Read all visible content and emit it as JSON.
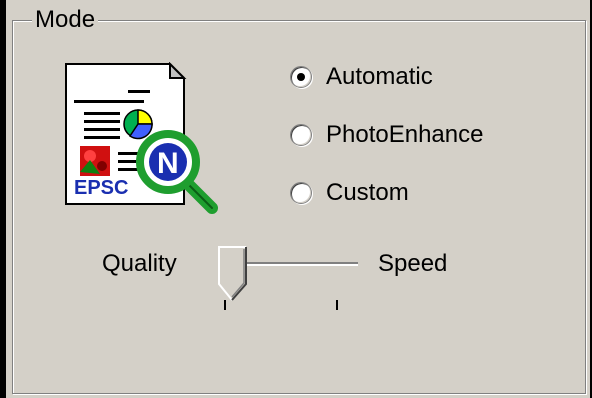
{
  "group": {
    "legend": "Mode"
  },
  "icon": {
    "name": "epson-photo-enhance-icon",
    "caption": "EPSC",
    "badge": "N"
  },
  "mode_options": [
    {
      "label": "Automatic",
      "checked": true
    },
    {
      "label": "PhotoEnhance",
      "checked": false
    },
    {
      "label": "Custom",
      "checked": false
    }
  ],
  "slider": {
    "left_label": "Quality",
    "right_label": "Speed",
    "value": 0,
    "ticks": 2
  },
  "colors": {
    "panel": "#d4d0c8",
    "background": "#000000",
    "magnifier": "#1f9e2f"
  }
}
